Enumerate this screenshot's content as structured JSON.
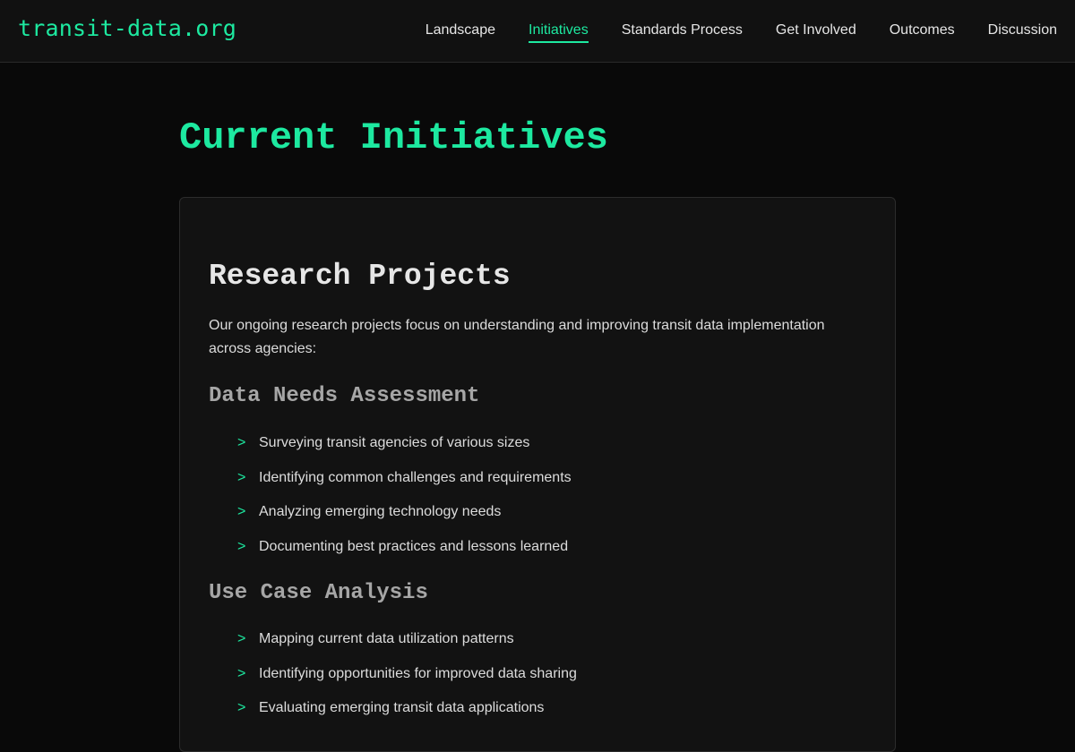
{
  "header": {
    "logo": "transit-data.org",
    "nav": [
      {
        "label": "Landscape",
        "active": false
      },
      {
        "label": "Initiatives",
        "active": true
      },
      {
        "label": "Standards Process",
        "active": false
      },
      {
        "label": "Get Involved",
        "active": false
      },
      {
        "label": "Outcomes",
        "active": false
      },
      {
        "label": "Discussion",
        "active": false
      }
    ]
  },
  "main": {
    "title": "Current Initiatives",
    "card": {
      "heading": "Research Projects",
      "intro": "Our ongoing research projects focus on understanding and improving transit data implementation across agencies:",
      "bullet_glyph": ">",
      "sections": [
        {
          "heading": "Data Needs Assessment",
          "items": [
            "Surveying transit agencies of various sizes",
            "Identifying common challenges and requirements",
            "Analyzing emerging technology needs",
            "Documenting best practices and lessons learned"
          ]
        },
        {
          "heading": "Use Case Analysis",
          "items": [
            "Mapping current data utilization patterns",
            "Identifying opportunities for improved data sharing",
            "Evaluating emerging transit data applications"
          ]
        }
      ]
    }
  },
  "colors": {
    "accent": "#1de9a0",
    "background": "#090909",
    "header_bg": "#111111",
    "card_bg": "#121212",
    "subheading": "#a6a6a6"
  }
}
